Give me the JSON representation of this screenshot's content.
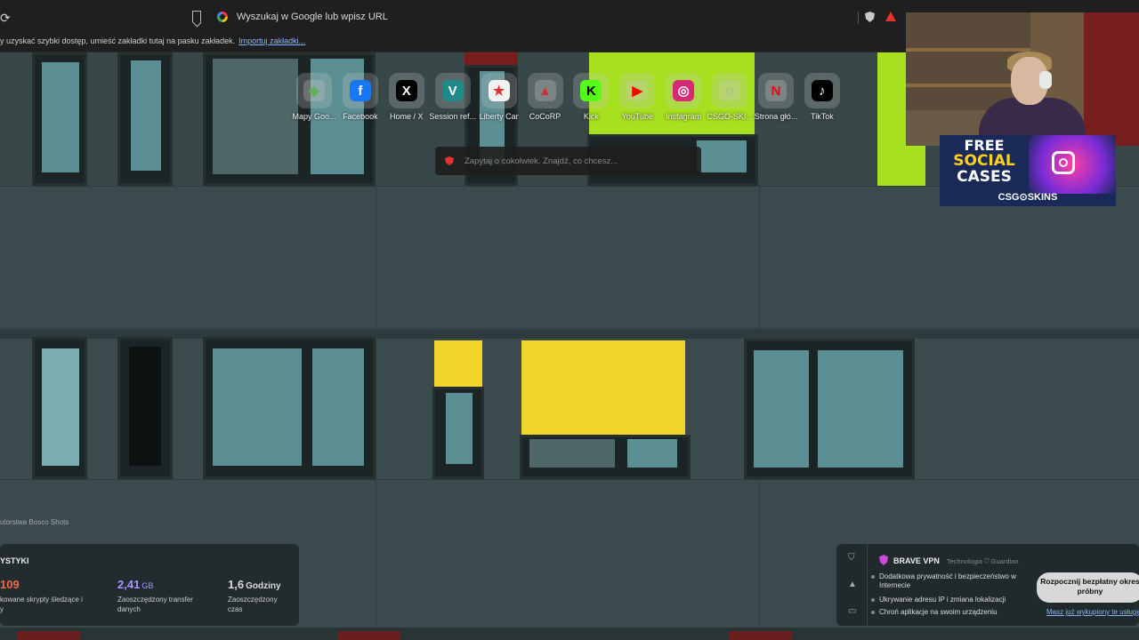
{
  "browser": {
    "omnibox_placeholder": "Wyszukaj w Google lub wpisz URL",
    "bookmarks_hint": "y uzyskać szybki dostęp, umieść zakładki tutaj na pasku zakładek.",
    "bookmarks_import_link": "Importuj zakładki..."
  },
  "top_sites": [
    {
      "label": "Mapy Goo...",
      "icon": "google-maps-icon",
      "glyph": "◆",
      "color": "#5fb15f",
      "bg": "rgba(200,200,200,0.3)"
    },
    {
      "label": "Facebook",
      "icon": "facebook-icon",
      "glyph": "f",
      "color": "#ffffff",
      "bg": "#1877f2"
    },
    {
      "label": "Home / X",
      "icon": "x-icon",
      "glyph": "X",
      "color": "#ffffff",
      "bg": "#000000"
    },
    {
      "label": "Session ref...",
      "icon": "session-icon",
      "glyph": "V",
      "color": "#ffffff",
      "bg": "#1f8a8a"
    },
    {
      "label": "Liberty Car",
      "icon": "liberty-car-icon",
      "glyph": "★",
      "color": "#d33",
      "bg": "#f2f2f2"
    },
    {
      "label": "CoCoRP",
      "icon": "cocorp-icon",
      "glyph": "▲",
      "color": "#c33",
      "bg": "rgba(200,200,200,0.3)"
    },
    {
      "label": "Kick",
      "icon": "kick-icon",
      "glyph": "K",
      "color": "#000000",
      "bg": "#53fc18"
    },
    {
      "label": "YouTube",
      "icon": "youtube-icon",
      "glyph": "▶",
      "color": "#ff0000",
      "bg": "rgba(200,200,200,0.3)"
    },
    {
      "label": "Instagram",
      "icon": "instagram-icon",
      "glyph": "◎",
      "color": "#ffffff",
      "bg": "#d62976"
    },
    {
      "label": "CSGO-SKI...",
      "icon": "csgo-skins-icon",
      "glyph": "◌",
      "color": "#5aa8e8",
      "bg": "rgba(200,200,200,0.3)"
    },
    {
      "label": "Strona głó...",
      "icon": "netflix-icon",
      "glyph": "N",
      "color": "#e50914",
      "bg": "rgba(200,200,200,0.3)"
    },
    {
      "label": "TikTok",
      "icon": "tiktok-icon",
      "glyph": "♪",
      "color": "#ffffff",
      "bg": "#000000"
    }
  ],
  "leo": {
    "placeholder": "Zapytaj o cokolwiek. Znajdź, co chcesz..."
  },
  "photo_credit": "utorstwa Bosco Shots",
  "stats": {
    "title": "YSTYKI",
    "items": [
      {
        "value": "109",
        "unit": "",
        "desc": "kowane skrypty śledzące i\ny",
        "color": "#f06a4a"
      },
      {
        "value": "2,41",
        "unit": "GB",
        "desc": "Zaoszczędzony transfer danych",
        "color": "#a796ff"
      },
      {
        "value": "1,6",
        "unit": "Godziny",
        "desc": "Zaoszczędzony czas",
        "color": "#ffffff"
      }
    ]
  },
  "vpn": {
    "brand": "BRAVE VPN",
    "tech": "Technologia ⛉ Guardian",
    "features": [
      "Dodatkowa prywatność i bezpieczeństwo w Internecie",
      "Ukrywanie adresu IP i zmiana lokalizacji",
      "Chroń aplikacje na swoim urządzeniu"
    ],
    "cta": "Rozpocznij bezpłatny okres próbny",
    "link": "Masz już wykupiony te usługę"
  },
  "promo": {
    "line1": "FREE",
    "line2": "SOCIAL",
    "line3": "CASES",
    "brand": "CSG⊙SKINS"
  }
}
